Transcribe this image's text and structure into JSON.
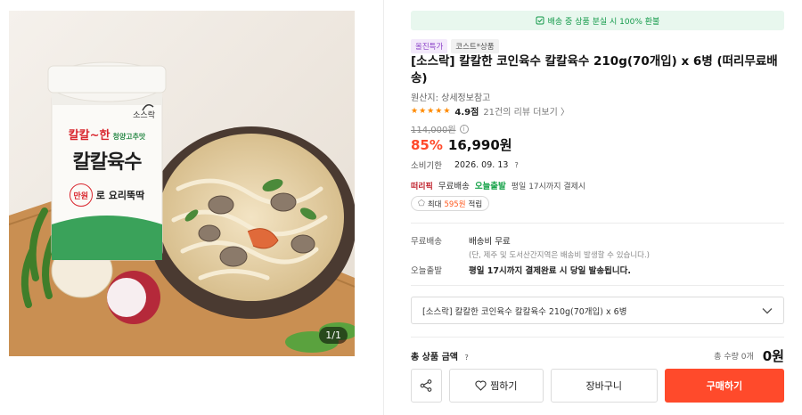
{
  "gallery": {
    "counter": "1/1"
  },
  "product_label": {
    "brand": "소스락",
    "line1": "칼칼~한",
    "line2": "청양고추맛",
    "main": "칼칼육수",
    "stamp": "만원",
    "sub": "로 요리뚝딱"
  },
  "banner": {
    "text": "배송 중 상품 분실 시 100% 환불",
    "color": "#139a4a"
  },
  "tags": [
    "올진특가",
    "코스트*상품"
  ],
  "title": "[소스락] 칼칼한 코인육수 칼칼육수 210g(70개입) x 6병 (떠리무료배송)",
  "origin": "원산지: 상세정보참고",
  "rating": {
    "stars": 5,
    "score": "4.9점",
    "reviews": "21건의 리뷰 더보기 〉"
  },
  "price": {
    "original": "114,000원",
    "discount": "85%",
    "final": "16,990원",
    "accent": "#ff4a2b"
  },
  "expiry": {
    "label": "소비기한",
    "date": "2026. 09. 13",
    "help": "?"
  },
  "delivery": {
    "logo": "떠리픽",
    "free": "무료배송",
    "today": "오늘출발",
    "note": "평일 17시까지 결제시"
  },
  "points": {
    "prefix": "최대",
    "amount": "595원",
    "suffix": "적립"
  },
  "shipping": {
    "fee_label": "무료배송",
    "fee_value": "배송비 무료",
    "fee_note": "(단, 제주 및 도서산간지역은 배송비 발생할 수 있습니다.)",
    "today_label": "오늘출발",
    "today_value": "평일 17시까지 결제완료 시 당일 발송됩니다."
  },
  "option": {
    "selected": "[소스락] 칼칼한 코인육수 칼칼육수 210g(70개입) x 6병"
  },
  "total": {
    "label": "총 상품 금액",
    "help": "?",
    "qty": "총 수량 0개",
    "amount": "0원"
  },
  "actions": {
    "wish": "찜하기",
    "cart": "장바구니",
    "buy": "구매하기"
  }
}
